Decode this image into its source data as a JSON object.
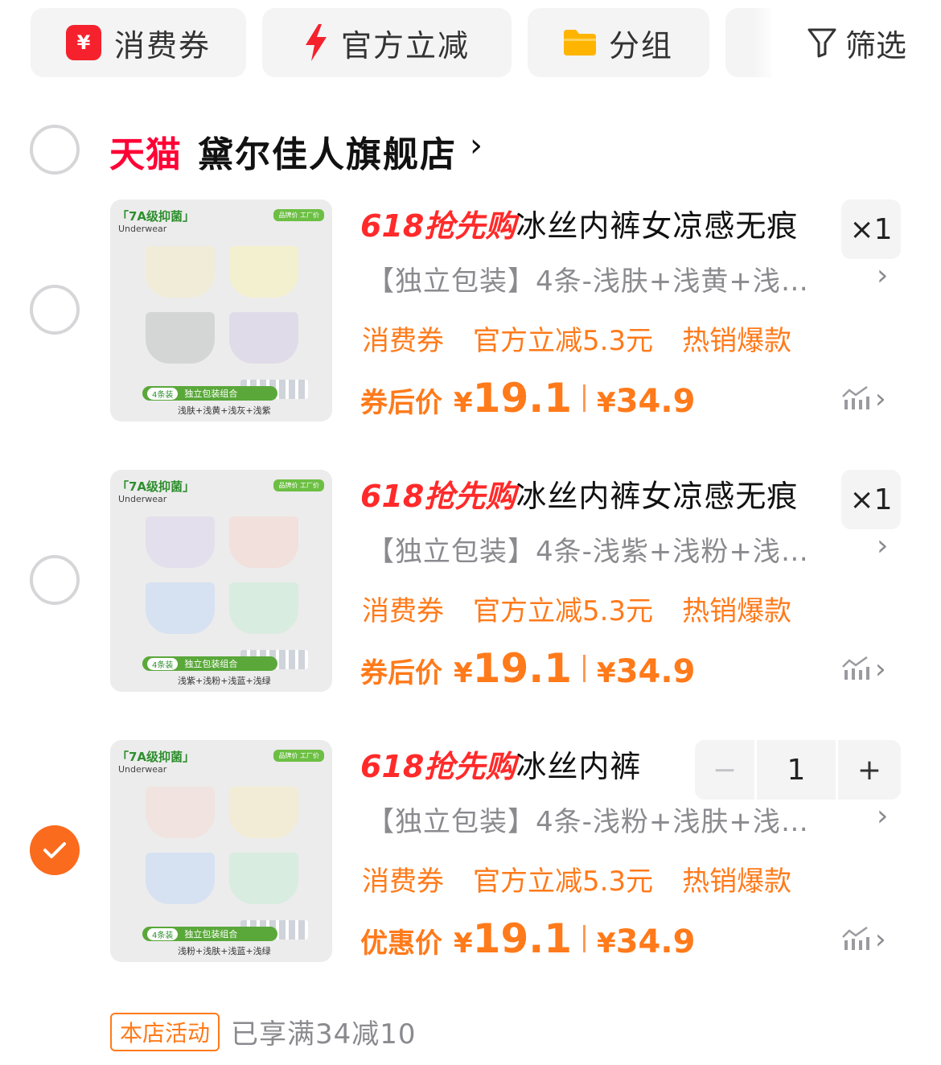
{
  "filter_bar": {
    "chips": [
      {
        "label": "消费券",
        "icon": "yen-ticket-icon"
      },
      {
        "label": "官方立减",
        "icon": "lightning-icon"
      },
      {
        "label": "分组",
        "icon": "folder-icon"
      }
    ],
    "filter_label": "筛选"
  },
  "store": {
    "platform": "天猫",
    "name": "黛尔佳人旗舰店",
    "chevron": "›"
  },
  "items": [
    {
      "selected": false,
      "image": {
        "tag": "「7A级抑菌」",
        "sub": "Underwear",
        "brand": "品牌价 工厂价",
        "count": "4条装",
        "band": "独立包装组合",
        "colors": "浅肤+浅黄+浅灰+浅紫"
      },
      "promo": "618抢先购",
      "title": "冰丝内裤女凉感无痕",
      "quantity_label": "×1",
      "sku": "【独立包装】4条-浅肤+浅黄+浅…",
      "tags": [
        "消费券",
        "官方立减5.3元",
        "热销爆款"
      ],
      "price_label": "券后价",
      "currency": "¥",
      "price": "19.1",
      "original_price": "34.9"
    },
    {
      "selected": false,
      "image": {
        "tag": "「7A级抑菌」",
        "sub": "Underwear",
        "brand": "品牌价 工厂价",
        "count": "4条装",
        "band": "独立包装组合",
        "colors": "浅紫+浅粉+浅蓝+浅绿"
      },
      "promo": "618抢先购",
      "title": "冰丝内裤女凉感无痕",
      "quantity_label": "×1",
      "sku": "【独立包装】4条-浅紫+浅粉+浅…",
      "tags": [
        "消费券",
        "官方立减5.3元",
        "热销爆款"
      ],
      "price_label": "券后价",
      "currency": "¥",
      "price": "19.1",
      "original_price": "34.9"
    },
    {
      "selected": true,
      "image": {
        "tag": "「7A级抑菌」",
        "sub": "Underwear",
        "brand": "品牌价 工厂价",
        "count": "4条装",
        "band": "独立包装组合",
        "colors": "浅粉+浅肤+浅蓝+浅绿"
      },
      "promo": "618抢先购",
      "title": "冰丝内裤",
      "stepper": {
        "minus": "−",
        "value": "1",
        "plus": "+"
      },
      "sku": "【独立包装】4条-浅粉+浅肤+浅…",
      "tags": [
        "消费券",
        "官方立减5.3元",
        "热销爆款"
      ],
      "price_label": "优惠价",
      "currency": "¥",
      "price": "19.1",
      "original_price": "34.9"
    }
  ],
  "activity": {
    "badge": "本店活动",
    "text": "已享满34减10"
  },
  "colors": {
    "accent_orange": "#ff7a1a",
    "tmall_red": "#ff0036",
    "checked": "#fa6b1e"
  }
}
